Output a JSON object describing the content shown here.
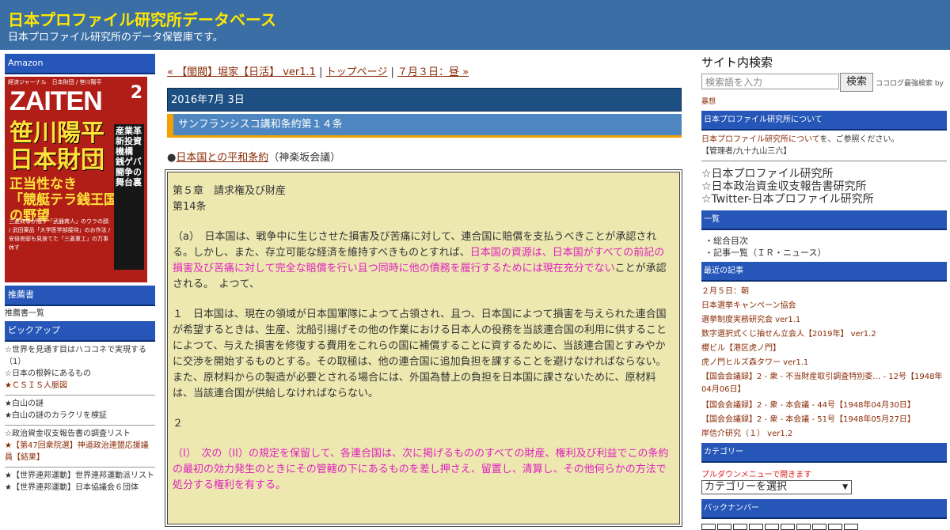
{
  "header": {
    "title": "日本プロファイル研究所データベース",
    "description": "日本プロファイル研究所のデータ保管庫です。"
  },
  "left": {
    "amazon_label": "Amazon",
    "book": {
      "tag": "経済ジャーナル　日本財団 / 笹川陽平",
      "logo": "ZAITEN",
      "issue": "2",
      "headline1": "笹川陽平",
      "headline2": "日本財団",
      "sub1": "正当性なき",
      "sub2": "「競艇テラ銭王国」",
      "sub3": "の野望",
      "side": "産業革新投資機構 銭ゲバ闘争の舞台裏",
      "small": "三菱商事が隠す「武器商人」のウラの顔 / 武田薬品「大学医学部接待」のお作法 / 安倍官邸も見捨てた「三菱重工」の万事休す"
    },
    "recommend_label": "推薦書",
    "recommend_link": "推薦書一覧",
    "pickup_label": "ピックアップ",
    "pickup_groups": [
      [
        "☆世界を見通す目はハココネで実現する（1）",
        "☆日本の根幹にあるもの",
        "★ＣＳＩＳ人脈図"
      ],
      [
        "★白山の謎",
        "★白山の謎のカラクリを検証"
      ],
      [
        "☆政治資金収支報告書の調査リスト",
        "★【第47回衆院選】神道政治連盟応援議員【結果】"
      ],
      [
        "★【世界連邦運動】世界連邦運動派リスト",
        "★【世界連邦運動】日本協議会６団体"
      ]
    ]
  },
  "center": {
    "nav_prev": "« 【閨閥】堀家【日活】 ver1.1",
    "nav_sep1": " | ",
    "nav_top": "トップページ",
    "nav_sep2": " | ",
    "nav_next": "７月３日：昼 »",
    "date": "2016年7月 3日",
    "title": "サンフランシスコ講和条約第１４条",
    "lead_bullet": "●",
    "lead_link": "日本国との平和条約",
    "lead_rest": "（神楽坂会議）",
    "chapter": "第５章　請求権及び財産",
    "article_no": "第14条",
    "para_a_1": "（a）　日本国は、戦争中に生じさせた損害及び苦痛に対して、連合国に賠償を支払うべきことが承認される。しかし、また、存立可能な経済を維持すべきものとすれば、",
    "para_a_mag": "日本国の資源は、日本国がすべての前記の損害及び苦痛に対して完全な賠償を行い且つ同時に他の債務を履行するためには現在充分でない",
    "para_a_2": "ことが承認される。　よつて、",
    "para_1": "１　日本国は、現在の領域が日本国軍隊によつて占領され、且つ、日本国によつて損害を与えられた連合国が希望するときは、生産、沈船引揚げその他の作業における日本人の役務を当該連合国の利用に供することによつて、与えた損害を修復する費用をこれらの国に補償することに資するために、当該連合国とすみやかに交渉を開始するものとする。その取極は、他の連合国に追加負担を課することを避けなければならない。また、原材料からの製造が必要とされる場合には、外国為替上の負担を日本国に課さないために、原材料は、当該連合国が供給しなければならない。",
    "para_2": "２",
    "para_I_label": "（I）　",
    "para_I_mag": "次の（II）の規定を保留して、各連合国は、次に掲げるもののすべての財産、権利及び利益でこの条約の最初の効力発生のときにその管轄の下にあるものを差し押さえ、留置し、清算し、その他何らかの方法で処分する権利を有する。"
  },
  "right": {
    "search_title": "サイト内検索",
    "search_placeholder": "検索語を入力",
    "search_button": "検索",
    "search_note": "ココログ最強検索 by",
    "search_note2": "暴想",
    "about_label": "日本プロファイル研究所について",
    "about_link": "日本プロファイル研究所について",
    "about_rest": "を、ご参照ください。",
    "admin": "【管理者/九十九山三六】",
    "big_links": [
      "☆日本プロファイル研究所",
      "☆日本政治資金収支報告書研究所",
      "☆Twitter-日本プロファイル研究所"
    ],
    "list_label": "一覧",
    "list_items": [
      "・総合目次",
      "・記事一覧（ＩＲ・ニュース）"
    ],
    "recent_label": "最近の記事",
    "recent_items": [
      "２月５日：朝",
      "日本選挙キャンペーン協会",
      "選挙制度実務研究会 ver1.1",
      "数字選択式くじ抽せん立会人【2019年】 ver1.2",
      "櫻ビル【港区虎ノ門】",
      "虎ノ門ヒルズ森タワー ver1.1",
      "【国会会議録】2 - 衆 - 不当財産取引調査特別委… - 12号【1948年04月06日】",
      "【国会会議録】2 - 衆 - 本会議 - 44号【1948年04月30日】",
      "【国会会議録】2 - 衆 - 本会議 - 51号【1948年05月27日】",
      "岸信介研究（１） ver1.2"
    ],
    "category_label": "カテゴリー",
    "category_note": "プルダウンメニューで開きます",
    "category_select": "カテゴリーを選択",
    "backnumber_label": "バックナンバー"
  }
}
